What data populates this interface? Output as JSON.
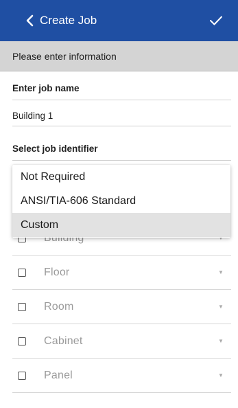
{
  "header": {
    "title": "Create Job",
    "background": "#1f4fa3"
  },
  "info": {
    "text": "Please enter information"
  },
  "job_name": {
    "label": "Enter job name",
    "value": "Building 1"
  },
  "job_identifier": {
    "label": "Select job identifier",
    "options": [
      {
        "label": "Not Required",
        "selected": false
      },
      {
        "label": "ANSI/TIA-606 Standard",
        "selected": false
      },
      {
        "label": "Custom",
        "selected": true
      }
    ]
  },
  "levels": [
    {
      "label": "Building",
      "checked": false
    },
    {
      "label": "Floor",
      "checked": false
    },
    {
      "label": "Room",
      "checked": false
    },
    {
      "label": "Cabinet",
      "checked": false
    },
    {
      "label": "Panel",
      "checked": false
    }
  ]
}
